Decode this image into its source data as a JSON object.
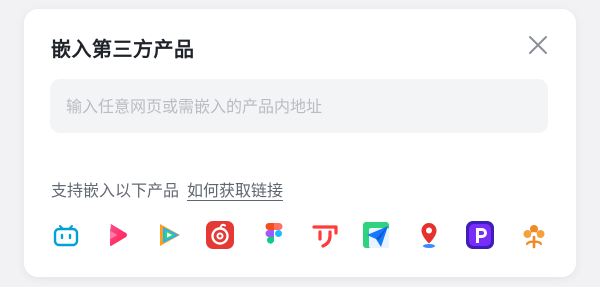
{
  "dialog": {
    "title": "嵌入第三方产品",
    "close_icon": "close-icon",
    "input": {
      "placeholder": "输入任意网页或需嵌入的产品内地址",
      "value": ""
    },
    "support_text": "支持嵌入以下产品",
    "help_link": "如何获取链接"
  },
  "products": [
    {
      "icon": "bilibili-tv-icon",
      "color": "#00a1d6"
    },
    {
      "icon": "play-arrow-pink-icon",
      "color": "#ff2d6b"
    },
    {
      "icon": "tencent-video-icon",
      "color": "#1ea5ff"
    },
    {
      "icon": "netease-music-icon",
      "color": "#e53935"
    },
    {
      "icon": "figma-icon",
      "color": "#f24e1e"
    },
    {
      "icon": "youku-tv-icon",
      "color": "#ff3b3b"
    },
    {
      "icon": "paper-plane-icon",
      "color": "#1677ff"
    },
    {
      "icon": "location-pin-icon",
      "color": "#e5322d"
    },
    {
      "icon": "purple-p-icon",
      "color": "#6a2cf6"
    },
    {
      "icon": "orange-flower-icon",
      "color": "#f08a24"
    }
  ]
}
